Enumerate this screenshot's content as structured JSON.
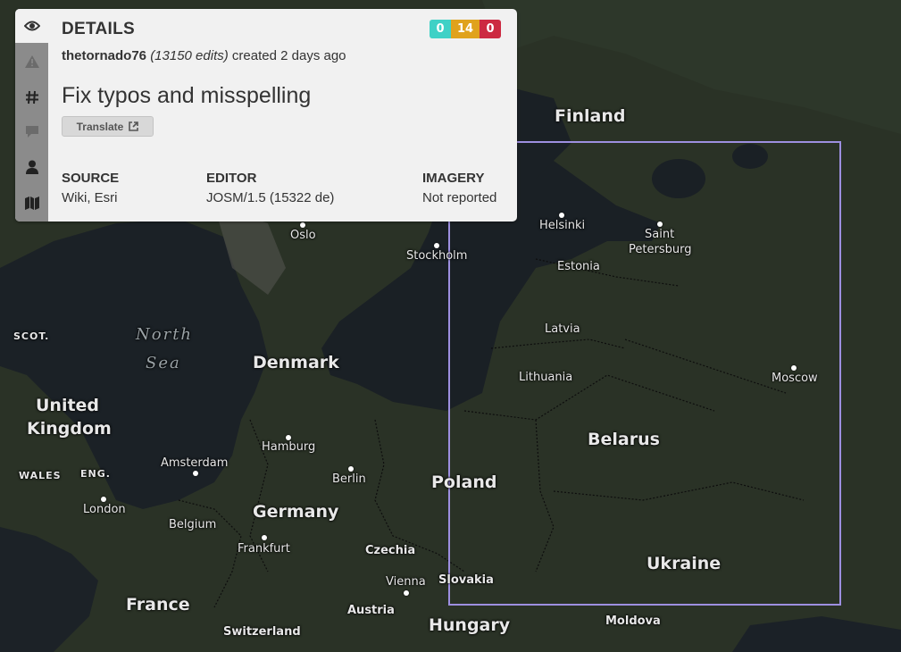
{
  "panel": {
    "title": "DETAILS",
    "counts": {
      "create": "0",
      "modify": "14",
      "delete": "0",
      "create_color": "#3fd1c6",
      "modify_color": "#e0a21c",
      "delete_color": "#cc2a41"
    },
    "user": "thetornado76",
    "edits": "(13150 edits)",
    "created": "created 2 days ago",
    "comment": "Fix typos and misspelling",
    "translate_label": "Translate",
    "source_label": "SOURCE",
    "source_value": "Wiki, Esri",
    "editor_label": "EDITOR",
    "editor_value": "JOSM/1.5 (15322 de)",
    "imagery_label": "IMAGERY",
    "imagery_value": "Not reported",
    "tabs": [
      "eye-icon",
      "warning-icon",
      "hash-icon",
      "comment-icon",
      "user-icon",
      "map-icon"
    ]
  },
  "map": {
    "bbox_color": "#9d8fe0",
    "labels": {
      "finland": "Finland",
      "helsinki": "Helsinki",
      "saint": "Saint",
      "petersburg": "Petersburg",
      "oslo": "Oslo",
      "stockholm": "Stockholm",
      "estonia": "Estonia",
      "latvia": "Latvia",
      "lithuania": "Lithuania",
      "moscow": "Moscow",
      "belarus": "Belarus",
      "north": "North",
      "sea": "Sea",
      "scot": "SCOT.",
      "denmark": "Denmark",
      "united": "United",
      "kingdom": "Kingdom",
      "wales": "WALES",
      "eng": "ENG.",
      "london": "London",
      "amsterdam": "Amsterdam",
      "hamburg": "Hamburg",
      "berlin": "Berlin",
      "poland": "Poland",
      "germany": "Germany",
      "belgium": "Belgium",
      "frankfurt": "Frankfurt",
      "czechia": "Czechia",
      "ukraine": "Ukraine",
      "vienna": "Vienna",
      "slovakia": "Slovakia",
      "france": "France",
      "austria": "Austria",
      "hungary": "Hungary",
      "moldova": "Moldova",
      "switzerland": "Switzerland"
    }
  }
}
